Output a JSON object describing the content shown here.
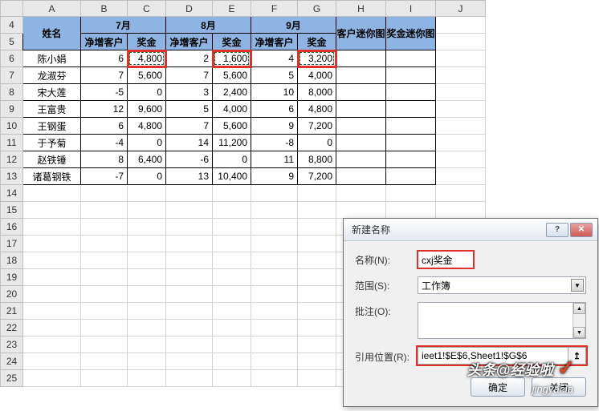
{
  "columns": [
    "A",
    "B",
    "C",
    "D",
    "E",
    "F",
    "G",
    "H",
    "I",
    "J"
  ],
  "row_start": 4,
  "row_end": 25,
  "headers": {
    "name": "姓名",
    "months": [
      "7月",
      "8月",
      "9月"
    ],
    "sub": [
      "净增客户",
      "奖金"
    ],
    "spark1": "客户迷你图",
    "spark2": "奖金迷你图"
  },
  "rows": [
    {
      "name": "陈小娟",
      "b": "6",
      "c": "4,800",
      "d": "2",
      "e": "1,600",
      "f": "4",
      "g": "3,200"
    },
    {
      "name": "龙淑芬",
      "b": "7",
      "c": "5,600",
      "d": "7",
      "e": "5,600",
      "f": "5",
      "g": "4,000"
    },
    {
      "name": "宋大莲",
      "b": "-5",
      "c": "0",
      "d": "3",
      "e": "2,400",
      "f": "10",
      "g": "8,000"
    },
    {
      "name": "王富贵",
      "b": "12",
      "c": "9,600",
      "d": "5",
      "e": "4,000",
      "f": "6",
      "g": "4,800"
    },
    {
      "name": "王钢蛋",
      "b": "6",
      "c": "4,800",
      "d": "7",
      "e": "5,600",
      "f": "9",
      "g": "7,200"
    },
    {
      "name": "于予菊",
      "b": "-4",
      "c": "0",
      "d": "14",
      "e": "11,200",
      "f": "-8",
      "g": "0"
    },
    {
      "name": "赵铁锤",
      "b": "8",
      "c": "6,400",
      "d": "-6",
      "e": "0",
      "f": "11",
      "g": "8,800"
    },
    {
      "name": "诸葛钢铁",
      "b": "-7",
      "c": "0",
      "d": "13",
      "e": "10,400",
      "f": "9",
      "g": "7,200"
    }
  ],
  "dialog": {
    "title": "新建名称",
    "labels": {
      "name": "名称(N):",
      "scope": "范围(S):",
      "comment": "批注(O):",
      "ref": "引用位置(R):"
    },
    "name_value": "cxj奖金",
    "scope_value": "工作簿",
    "ref_value": "ieet1!$E$6,Sheet1!$G$6",
    "ok": "确定",
    "cancel": "关闭"
  },
  "watermark": {
    "line1": "头条@经验啦",
    "line2": "jingyanla",
    "check": "✓"
  }
}
